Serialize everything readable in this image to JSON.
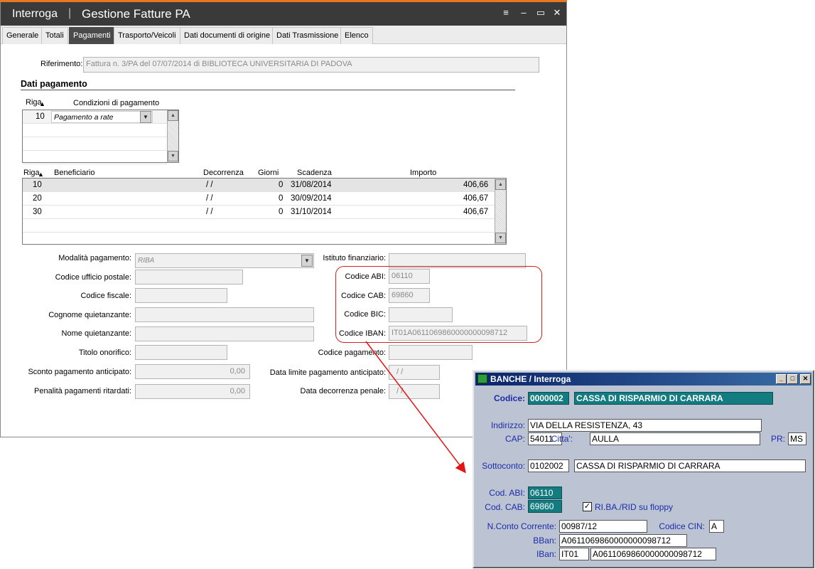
{
  "main_window": {
    "title_app": "Interroga",
    "title_separator": "|",
    "title_doc": "Gestione Fatture PA",
    "controls": {
      "menu": "≡",
      "minimize": "–",
      "maximize": "▭",
      "close": "✕"
    },
    "tabs": [
      {
        "label": "Generale"
      },
      {
        "label": "Totali"
      },
      {
        "label": "Pagamenti"
      },
      {
        "label": "Trasporto/Veicoli"
      },
      {
        "label": "Dati documenti di origine"
      },
      {
        "label": "Dati Trasmissione"
      },
      {
        "label": "Elenco"
      }
    ],
    "active_tab": "Pagamenti",
    "riferimento_label": "Riferimento:",
    "riferimento_value": "Fattura n. 3/PA del 07/07/2014 di BIBLIOTECA UNIVERSITARIA DI PADOVA",
    "section_title": "Dati pagamento",
    "conditions_grid": {
      "col_riga": "Riga",
      "col_condizioni": "Condizioni di pagamento",
      "rows": [
        {
          "riga": "10",
          "condizioni": "Pagamento a rate"
        }
      ]
    },
    "payments_grid": {
      "col_riga": "Riga",
      "col_beneficiario": "Beneficiario",
      "col_decorrenza": "Decorrenza",
      "col_giorni": "Giorni",
      "col_scadenza": "Scadenza",
      "col_importo": "Importo",
      "rows": [
        {
          "riga": "10",
          "beneficiario": "",
          "decorrenza": "/ /",
          "giorni": "0",
          "scadenza": "31/08/2014",
          "importo": "406,66"
        },
        {
          "riga": "20",
          "beneficiario": "",
          "decorrenza": "/ /",
          "giorni": "0",
          "scadenza": "30/09/2014",
          "importo": "406,67"
        },
        {
          "riga": "30",
          "beneficiario": "",
          "decorrenza": "/ /",
          "giorni": "0",
          "scadenza": "31/10/2014",
          "importo": "406,67"
        }
      ]
    },
    "form": {
      "modalita_label": "Modalità pagamento:",
      "modalita_value": "RIBA",
      "ufficio_postale_label": "Codice ufficio postale:",
      "ufficio_postale_value": "",
      "codice_fiscale_label": "Codice fiscale:",
      "codice_fiscale_value": "",
      "cognome_label": "Cognome quietanzante:",
      "cognome_value": "",
      "nome_label": "Nome quietanzante:",
      "nome_value": "",
      "titolo_label": "Titolo onorifico:",
      "titolo_value": "",
      "sconto_label": "Sconto pagamento anticipato:",
      "sconto_value": "0,00",
      "penalita_label": "Penalità pagamenti ritardati:",
      "penalita_value": "0,00",
      "istituto_label": "Istituto finanziario:",
      "istituto_value": "",
      "abi_label": "Codice ABI:",
      "abi_value": "06110",
      "cab_label": "Codice CAB:",
      "cab_value": "69860",
      "bic_label": "Codice BIC:",
      "bic_value": "",
      "iban_label": "Codice IBAN:",
      "iban_value": "IT01A0611069860000000098712",
      "codice_pagamento_label": "Codice pagamento:",
      "codice_pagamento_value": "",
      "data_limite_label": "Data limite pagamento anticipato:",
      "data_limite_value": "/ /",
      "data_decorrenza_label": "Data decorrenza penale:",
      "data_decorrenza_value": "/ /"
    }
  },
  "banche_window": {
    "title": "BANCHE / Interroga",
    "codice_label": "Codice:",
    "codice_value": "0000002",
    "descrizione_value": "CASSA DI RISPARMIO DI CARRARA",
    "indirizzo_label": "Indirizzo:",
    "indirizzo_value": "VIA DELLA RESISTENZA, 43",
    "cap_label": "CAP:",
    "cap_value": "54011",
    "citta_label": "Citta':",
    "citta_value": "AULLA",
    "pr_label": "PR:",
    "pr_value": "MS",
    "sottoconto_label": "Sottoconto:",
    "sottoconto_value": "0102002",
    "sottoconto_desc": "CASSA DI RISPARMIO DI CARRARA",
    "abi_label": "Cod. ABI:",
    "abi_value": "06110",
    "cab_label": "Cod. CAB:",
    "cab_value": "69860",
    "floppy_label": "RI.BA./RID su floppy",
    "floppy_checked": true,
    "conto_label": "N.Conto Corrente:",
    "conto_value": "00987/12",
    "cin_label": "Codice CIN:",
    "cin_value": "A",
    "bban_label": "BBan:",
    "bban_value": "A0611069860000000098712",
    "iban_label": "IBan:",
    "iban_prefix": "IT01",
    "iban_value": "A0611069860000000098712"
  }
}
